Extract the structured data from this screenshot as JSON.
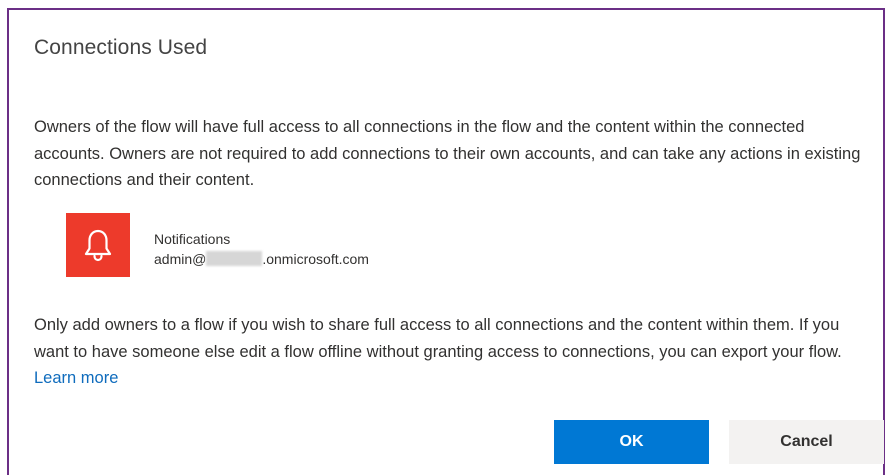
{
  "dialog": {
    "title": "Connections Used",
    "paragraph1": "Owners of the flow will have full access to all connections in the flow and the content within the connected accounts. Owners are not required to add connections to their own accounts, and can take any actions in existing connections and their content.",
    "connection": {
      "name": "Notifications",
      "account_prefix": "admin@",
      "account_suffix": ".onmicrosoft.com",
      "icon": "bell-icon",
      "tile_color": "#ed3a2b"
    },
    "paragraph2": "Only add owners to a flow if you wish to share full access to all connections and the content within them. If you want to have someone else edit a flow offline without granting access to connections, you can export your flow.",
    "learn_more": "Learn more",
    "ok_label": "OK",
    "cancel_label": "Cancel"
  },
  "colors": {
    "primary_button": "#0078d4",
    "link": "#0f6cbd",
    "frame_border": "#6b2f86"
  }
}
